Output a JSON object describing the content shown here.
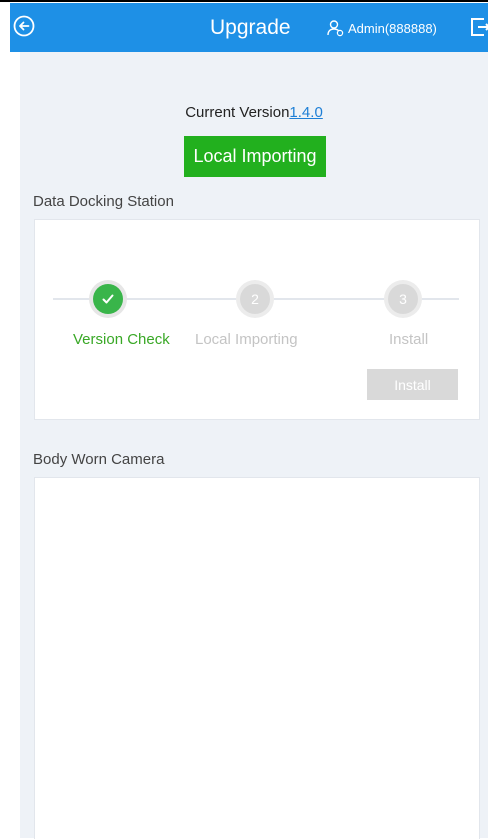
{
  "header": {
    "title": "Upgrade",
    "user": "Admin(888888)",
    "color": "#1e90e6"
  },
  "version": {
    "label": "Current Version",
    "value": "1.4.0"
  },
  "import_button": "Local Importing",
  "docking": {
    "section_label": "Data Docking Station",
    "steps": [
      {
        "number": "1",
        "label": "Version Check",
        "state": "done"
      },
      {
        "number": "2",
        "label": "Local Importing",
        "state": "pending"
      },
      {
        "number": "3",
        "label": "Install",
        "state": "pending"
      }
    ],
    "install_button": "Install"
  },
  "camera": {
    "section_label": "Body Worn Camera"
  },
  "colors": {
    "accent": "#1e90e6",
    "success": "#22b01e",
    "step_done": "#39b54a",
    "disabled": "#d9d9d9",
    "background": "#eef2f7"
  }
}
